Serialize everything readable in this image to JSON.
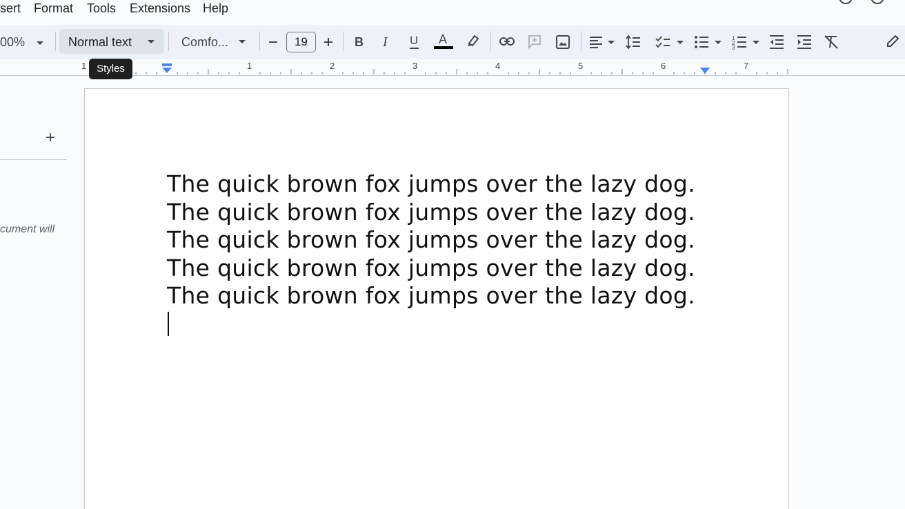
{
  "menu": {
    "insert_partial": "sert",
    "format": "Format",
    "tools": "Tools",
    "extensions": "Extensions",
    "help": "Help"
  },
  "toolbar": {
    "zoom": "00%",
    "paragraph_style": "Normal text",
    "font": "Comfo...",
    "font_size": "19",
    "text_color": "#000000",
    "tooltip": "Styles"
  },
  "ruler": {
    "numbers": [
      "1",
      "1",
      "2",
      "3",
      "4",
      "5",
      "6",
      "7"
    ]
  },
  "left_panel": {
    "hint": "cument will"
  },
  "document": {
    "lines": [
      "The quick brown fox jumps over the lazy dog.",
      "The quick brown fox jumps over the lazy dog.",
      "The quick brown fox jumps over the lazy dog.",
      "The quick brown fox jumps over the lazy dog.",
      "The quick brown fox jumps over the lazy dog."
    ]
  },
  "colors": {
    "toolbar_bg": "#edf2fa",
    "indent_marker": "#4a86e8"
  }
}
